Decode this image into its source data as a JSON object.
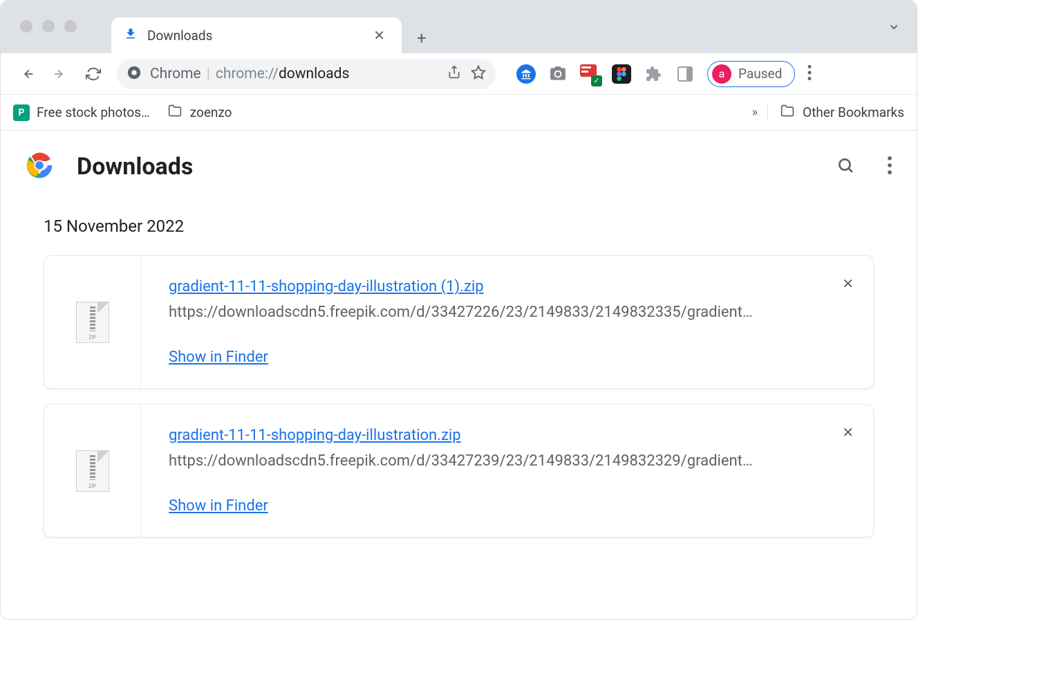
{
  "tab": {
    "title": "Downloads"
  },
  "address": {
    "scheme_label": "Chrome",
    "url_light": "chrome://",
    "url_dark": "downloads"
  },
  "profile": {
    "avatar_letter": "a",
    "status": "Paused"
  },
  "bookmarks": {
    "items": [
      {
        "label": "Free stock photos…",
        "icon": "pexels"
      },
      {
        "label": "zoenzo",
        "icon": "folder"
      }
    ],
    "other_label": "Other Bookmarks"
  },
  "page": {
    "title": "Downloads"
  },
  "date_header": "15 November 2022",
  "downloads": [
    {
      "filename": "gradient-11-11-shopping-day-illustration (1).zip",
      "url": "https://downloadscdn5.freepik.com/d/33427226/23/2149833/2149832335/gradient…",
      "action": "Show in Finder",
      "ext": "ZIP"
    },
    {
      "filename": "gradient-11-11-shopping-day-illustration.zip",
      "url": "https://downloadscdn5.freepik.com/d/33427239/23/2149833/2149832329/gradient…",
      "action": "Show in Finder",
      "ext": "ZIP"
    }
  ]
}
